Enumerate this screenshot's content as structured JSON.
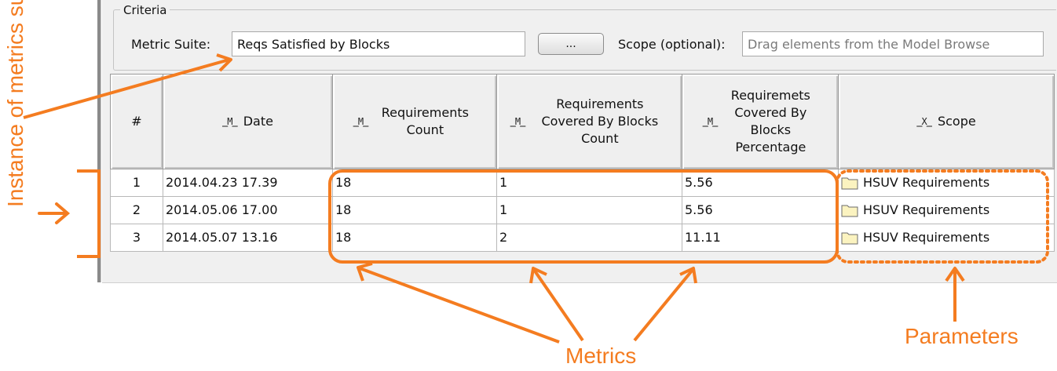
{
  "criteria": {
    "title": "Criteria",
    "metric_suite_label": "Metric Suite:",
    "metric_suite_value": "Reqs Satisfied by Blocks",
    "browse_label": "...",
    "scope_label": "Scope (optional):",
    "scope_placeholder": "Drag elements from the Model Browse"
  },
  "table": {
    "headers": [
      "#",
      "Date",
      "Requirements Count",
      "Requirements Covered By Blocks Count",
      "Requiremets Covered By Blocks Percentage",
      "Scope"
    ],
    "rows": [
      {
        "index": "1",
        "date": "2014.04.23 17.39",
        "count": "18",
        "covered": "1",
        "percentage": "5.56",
        "scope": "HSUV Requirements"
      },
      {
        "index": "2",
        "date": "2014.05.06 17.00",
        "count": "18",
        "covered": "1",
        "percentage": "5.56",
        "scope": "HSUV Requirements"
      },
      {
        "index": "3",
        "date": "2014.05.07 13.16",
        "count": "18",
        "covered": "2",
        "percentage": "11.11",
        "scope": "HSUV Requirements"
      }
    ]
  },
  "annotations": {
    "instance": "Instance of metrics suite",
    "metrics": "Metrics",
    "parameters": "Parameters"
  },
  "colors": {
    "accent": "#f47c20",
    "folder": "#fbf3c0"
  },
  "icons": {
    "metric_column": "metric-column-icon",
    "scope_column": "scope-column-icon",
    "folder": "folder-icon"
  }
}
